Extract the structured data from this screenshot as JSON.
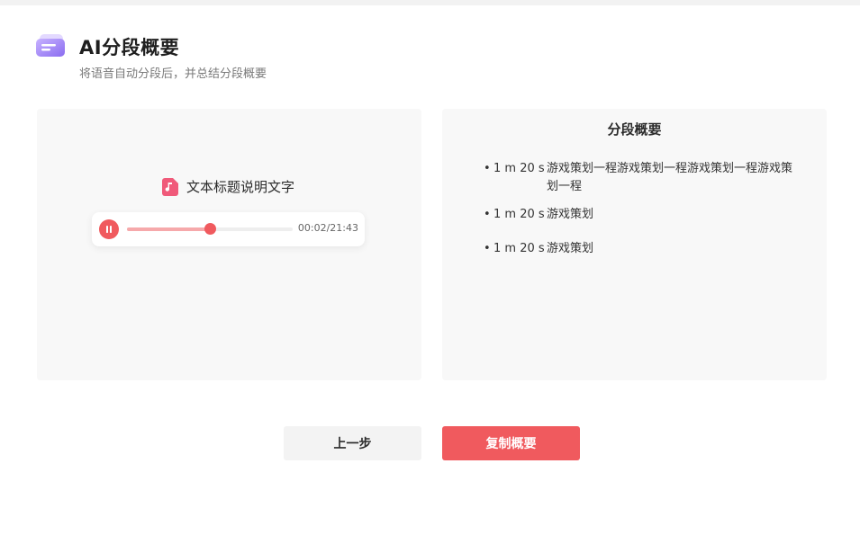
{
  "header": {
    "title": "AI分段概要",
    "subtitle": "将语音自动分段后，并总结分段概要",
    "logo_icon": "layers-logo-icon"
  },
  "audio": {
    "title": "文本标题说明文字",
    "file_icon": "music-file-icon",
    "time": "00:02/21:43",
    "progress": 0.5,
    "pause_icon": "pause-icon"
  },
  "summary": {
    "heading": "分段概要",
    "items": [
      {
        "bullet": "•",
        "stamp": "1 m 20 s",
        "text": "游戏策划一程游戏策划一程游戏策划一程游戏策划一程"
      },
      {
        "bullet": "•",
        "stamp": "1 m 20 s",
        "text": "游戏策划"
      },
      {
        "bullet": "•",
        "stamp": "1 m 20 s",
        "text": "游戏策划"
      }
    ]
  },
  "buttons": {
    "prev_label": "上一步",
    "copy_label": "复制概要"
  },
  "colors": {
    "accent": "#f05a5e",
    "accent_light": "#f6a9ab",
    "panel_bg": "#f8f8f8",
    "logo_purple": "#9b7cf0"
  }
}
